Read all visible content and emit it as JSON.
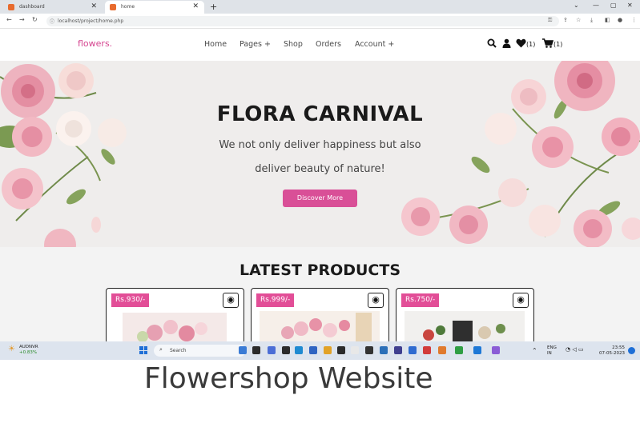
{
  "browser": {
    "tabs": [
      {
        "label": "dashboard",
        "active": false
      },
      {
        "label": "home",
        "active": true
      }
    ],
    "url": "localhost/project/home.php"
  },
  "site": {
    "logo": "flowers.",
    "nav": [
      "Home",
      "Pages +",
      "Shop",
      "Orders",
      "Account +"
    ],
    "wishlist_count": "(1)",
    "cart_count": "(1)"
  },
  "hero": {
    "title": "FLORA CARNIVAL",
    "subtitle_line1": "We not only deliver happiness but also",
    "subtitle_line2": "deliver beauty of nature!",
    "button": "Discover More"
  },
  "products": {
    "title": "LATEST PRODUCTS",
    "items": [
      {
        "price": "Rs.930/-"
      },
      {
        "price": "Rs.999/-"
      },
      {
        "price": "Rs.750/-"
      }
    ]
  },
  "taskbar": {
    "weather_label": "AUDNVR",
    "weather_value": "+0.83%",
    "search_placeholder": "Search",
    "lang_line1": "ENG",
    "lang_line2": "IN",
    "time": "23:55",
    "date": "07-05-2023"
  },
  "caption": "Flowershop Website",
  "colors": {
    "brand_pink": "#d94f97",
    "price_pink": "#e24e97",
    "hero_bg": "#efedec"
  }
}
